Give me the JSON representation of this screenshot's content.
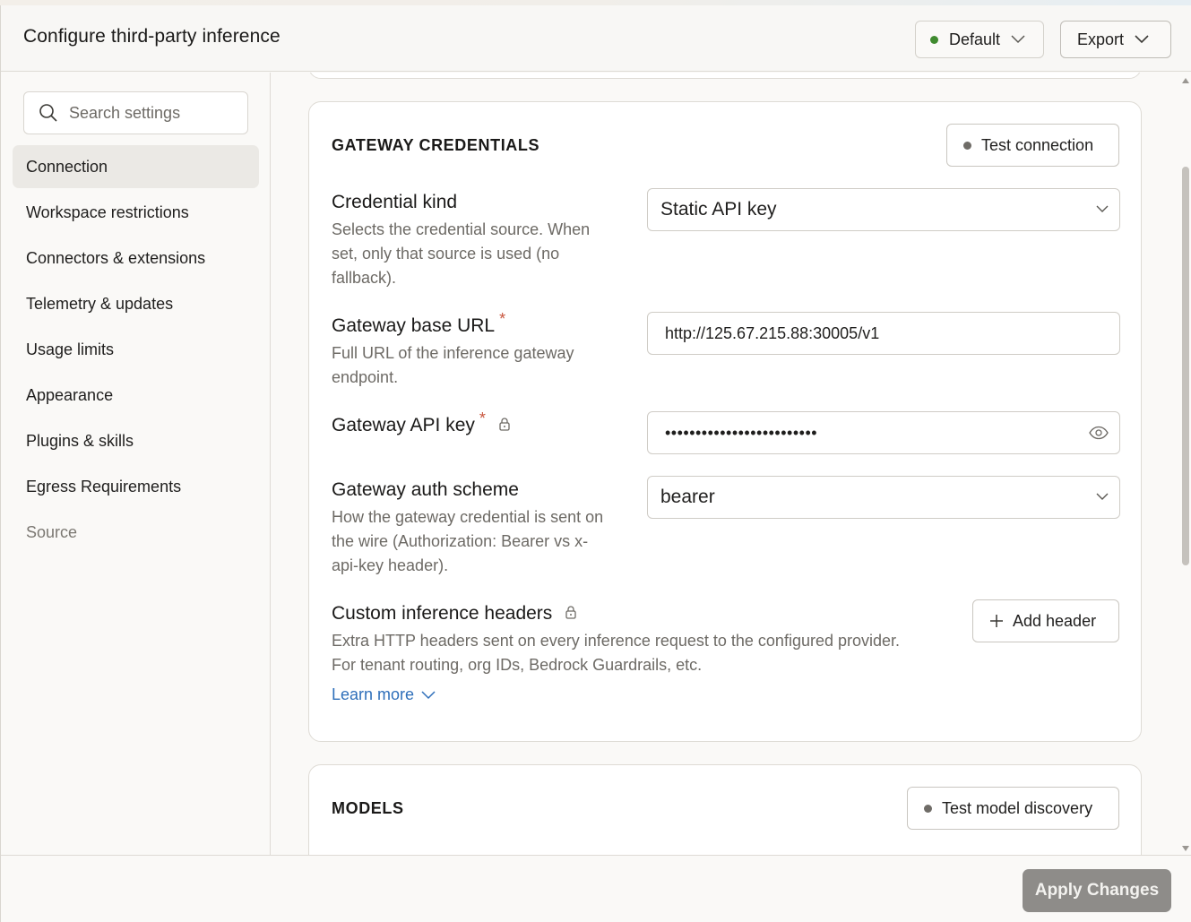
{
  "header": {
    "title": "Configure third-party inference",
    "profile_label": "Default",
    "export_label": "Export"
  },
  "sidebar": {
    "search_placeholder": "Search settings",
    "items": [
      {
        "label": "Connection"
      },
      {
        "label": "Workspace restrictions"
      },
      {
        "label": "Connectors & extensions"
      },
      {
        "label": "Telemetry & updates"
      },
      {
        "label": "Usage limits"
      },
      {
        "label": "Appearance"
      },
      {
        "label": "Plugins & skills"
      },
      {
        "label": "Egress Requirements"
      },
      {
        "label": "Source"
      }
    ]
  },
  "gateway": {
    "section_title": "GATEWAY CREDENTIALS",
    "test_button": "Test connection",
    "credential_kind": {
      "label": "Credential kind",
      "desc_lines": [
        "Selects the credential source. When",
        "set, only that source is used (no",
        "fallback)."
      ],
      "value": "Static API key"
    },
    "base_url": {
      "label": "Gateway base URL",
      "required_mark": "*",
      "desc_lines": [
        "Full URL of the inference gateway",
        "endpoint."
      ],
      "value": "http://125.67.215.88:30005/v1"
    },
    "api_key": {
      "label": "Gateway API key",
      "required_mark": "*",
      "masked_value": "•••••••••••••••••••••••••"
    },
    "auth_scheme": {
      "label": "Gateway auth scheme",
      "desc_lines": [
        "How the gateway credential is sent on",
        "the wire (Authorization: Bearer vs x-",
        "api-key header)."
      ],
      "value": "bearer"
    },
    "headers": {
      "label": "Custom inference headers",
      "desc_lines": [
        "Extra HTTP headers sent on every inference request to the configured provider.",
        "For tenant routing, org IDs, Bedrock Guardrails, etc."
      ],
      "add_button": "Add header",
      "learn_more": "Learn more"
    }
  },
  "models": {
    "section_title": "MODELS",
    "test_button": "Test model discovery"
  },
  "footer": {
    "apply_label": "Apply Changes"
  },
  "colors": {
    "status_green": "#3f8a2f",
    "required_red": "#c8553d",
    "link_blue": "#2f6fba",
    "apply_bg": "#8e8c89"
  }
}
